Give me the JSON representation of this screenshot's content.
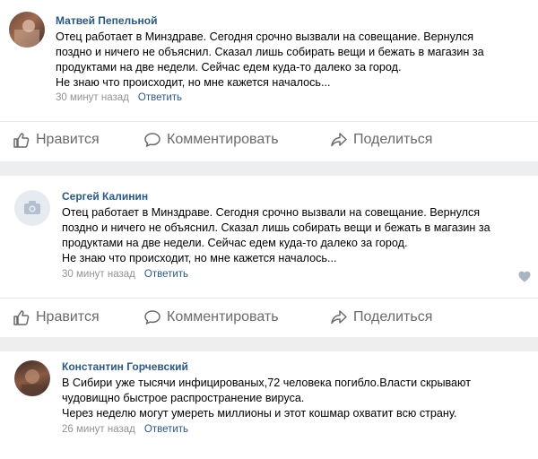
{
  "posts": [
    {
      "author": "Матвей Пепельной",
      "text": "Отец работает в Минздраве. Сегодня срочно вызвали на совещание. Вернулся\nпоздно и ничего не объяснил. Сказал лишь собирать вещи и бежать в магазин за\nпродуктами на две недели. Сейчас едем куда-то далеко за город.\nНе знаю что происходит, но мне кажется началось...",
      "time": "30 минут назад",
      "reply": "Ответить",
      "avatar_icon": "user-photo",
      "show_heart": false
    },
    {
      "author": "Сергей Калинин",
      "text": "Отец работает в Минздраве. Сегодня срочно вызвали на совещание. Вернулся\nпоздно и ничего не объяснил. Сказал лишь собирать вещи и бежать в магазин за\nпродуктами на две недели. Сейчас едем куда-то далеко за город.\nНе знаю что происходит, но мне кажется началось...",
      "time": "30 минут назад",
      "reply": "Ответить",
      "avatar_icon": "camera-placeholder",
      "show_heart": true
    },
    {
      "author": "Константин Горчевский",
      "text": "В Сибири уже тысячи инфицированых,72 человека погибло.Власти скрывают\nчудовищно быстрое распространение вируса.\nЧерез неделю могут умереть миллионы и этот кошмар охватит всю страну.",
      "time": "26 минут назад",
      "reply": "Ответить",
      "avatar_icon": "user-photo"
    }
  ],
  "actions": {
    "like": "Нравится",
    "comment": "Комментировать",
    "share": "Поделиться"
  },
  "colors": {
    "link": "#2a5885",
    "meta": "#939393",
    "action": "#6a6a6a",
    "background": "#edeef0"
  }
}
